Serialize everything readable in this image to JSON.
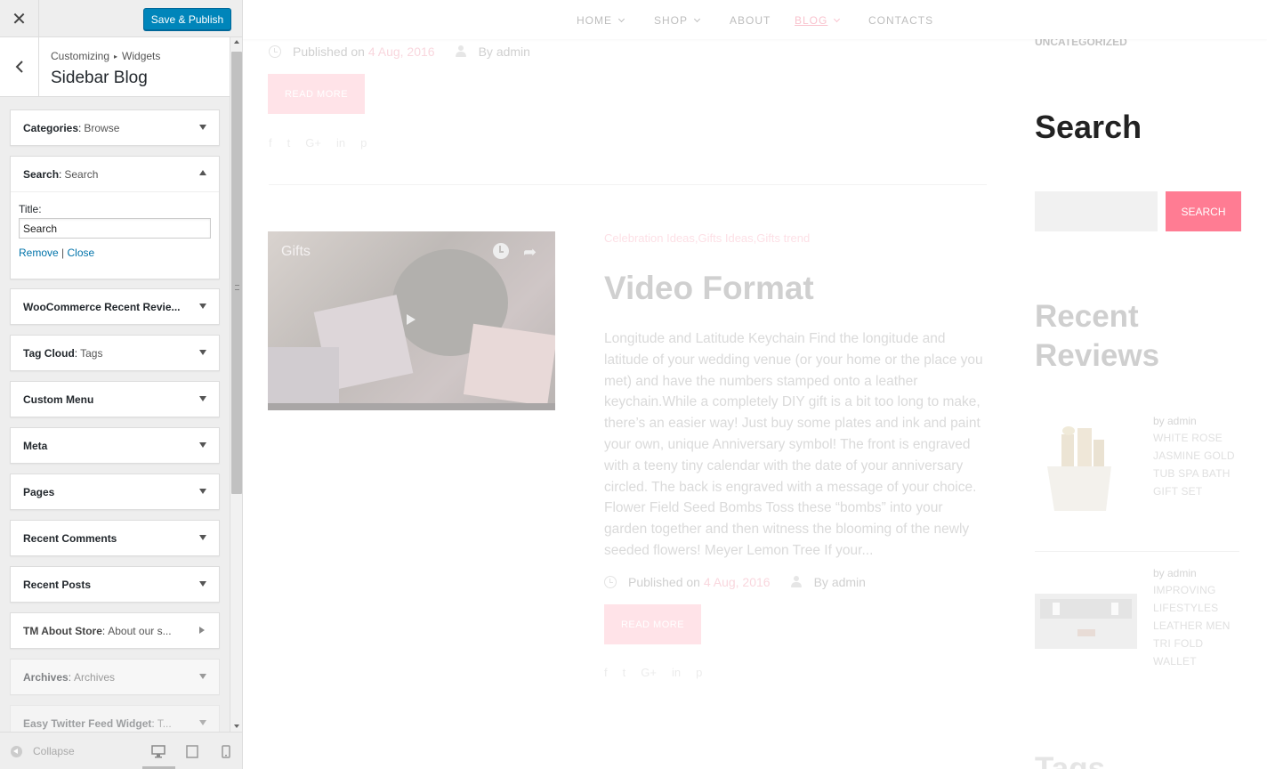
{
  "customizer": {
    "close_label": "✕",
    "save_label": "Save & Publish",
    "breadcrumb": [
      "Customizing",
      "Widgets"
    ],
    "section_title": "Sidebar Blog",
    "widgets": [
      {
        "name": "Categories",
        "sub": "Browse",
        "state": "collapsed"
      },
      {
        "name": "Search",
        "sub": "Search",
        "state": "expanded",
        "title_label": "Title:",
        "title_value": "Search",
        "remove_label": "Remove",
        "separator": "|",
        "close_label": "Close"
      },
      {
        "name": "WooCommerce Recent Revie...",
        "sub": "",
        "state": "collapsed"
      },
      {
        "name": "Tag Cloud",
        "sub": "Tags",
        "state": "collapsed"
      },
      {
        "name": "Custom Menu",
        "sub": "",
        "state": "collapsed"
      },
      {
        "name": "Meta",
        "sub": "",
        "state": "collapsed"
      },
      {
        "name": "Pages",
        "sub": "",
        "state": "collapsed"
      },
      {
        "name": "Recent Comments",
        "sub": "",
        "state": "collapsed"
      },
      {
        "name": "Recent Posts",
        "sub": "",
        "state": "collapsed"
      },
      {
        "name": "TM About Store",
        "sub": "About our s...",
        "state": "inactive"
      },
      {
        "name": "Archives",
        "sub": "Archives",
        "state": "faded"
      },
      {
        "name": "Easy Twitter Feed Widget",
        "sub": "T...",
        "state": "faded"
      }
    ],
    "collapse_label": "Collapse",
    "devices": [
      "desktop-icon",
      "tablet-icon",
      "mobile-icon"
    ],
    "accent": "#0085ba"
  },
  "preview": {
    "nav": [
      {
        "label": "HOME",
        "dropdown": true
      },
      {
        "label": "SHOP",
        "dropdown": true
      },
      {
        "label": "ABOUT",
        "dropdown": false
      },
      {
        "label": "BLOG",
        "dropdown": true,
        "active": true
      },
      {
        "label": "CONTACTS",
        "dropdown": false
      }
    ],
    "post1": {
      "published_label": "Published on",
      "date": "4 Aug, 2016",
      "by": "By admin",
      "read_more": "READ MORE",
      "social": [
        "f",
        "t",
        "G+",
        "in",
        "p"
      ]
    },
    "post2": {
      "video_title": "Gifts",
      "categories": "Celebration Ideas,Gifts Ideas,Gifts trend",
      "title": "Video Format",
      "excerpt": "Longitude and Latitude Keychain Find the longitude and latitude of your wedding venue (or your home or the place you met) and have the numbers stamped onto a leather keychain.While a completely DIY gift is a bit too long to make, there’s an easier way! Just buy some plates and ink and paint your own, unique Anniversary symbol! The front is engraved with a teeny tiny calendar with the date of your anniversary circled. The back is engraved with a message of your choice.  Flower Field Seed Bombs Toss these “bombs” into your garden together and then witness the blooming of the newly seeded flowers! Meyer Lemon Tree If your...",
      "published_label": "Published on",
      "date": "4 Aug, 2016",
      "by": "By admin",
      "read_more": "READ MORE",
      "social": [
        "f",
        "t",
        "G+",
        "in",
        "p"
      ]
    },
    "sidebar": {
      "uncategorized": "UNCATEGORIZED",
      "search_title": "Search",
      "search_button": "SEARCH",
      "recent_title": "Recent Reviews",
      "reviews": [
        {
          "by": "by admin",
          "name": "WHITE ROSE JASMINE GOLD TUB SPA BATH GIFT SET"
        },
        {
          "by": "by admin",
          "name": "IMPROVING LIFESTYLES LEATHER MEN TRI FOLD WALLET"
        }
      ],
      "tags_title": "Tags"
    },
    "accent": "#ff7c93"
  }
}
